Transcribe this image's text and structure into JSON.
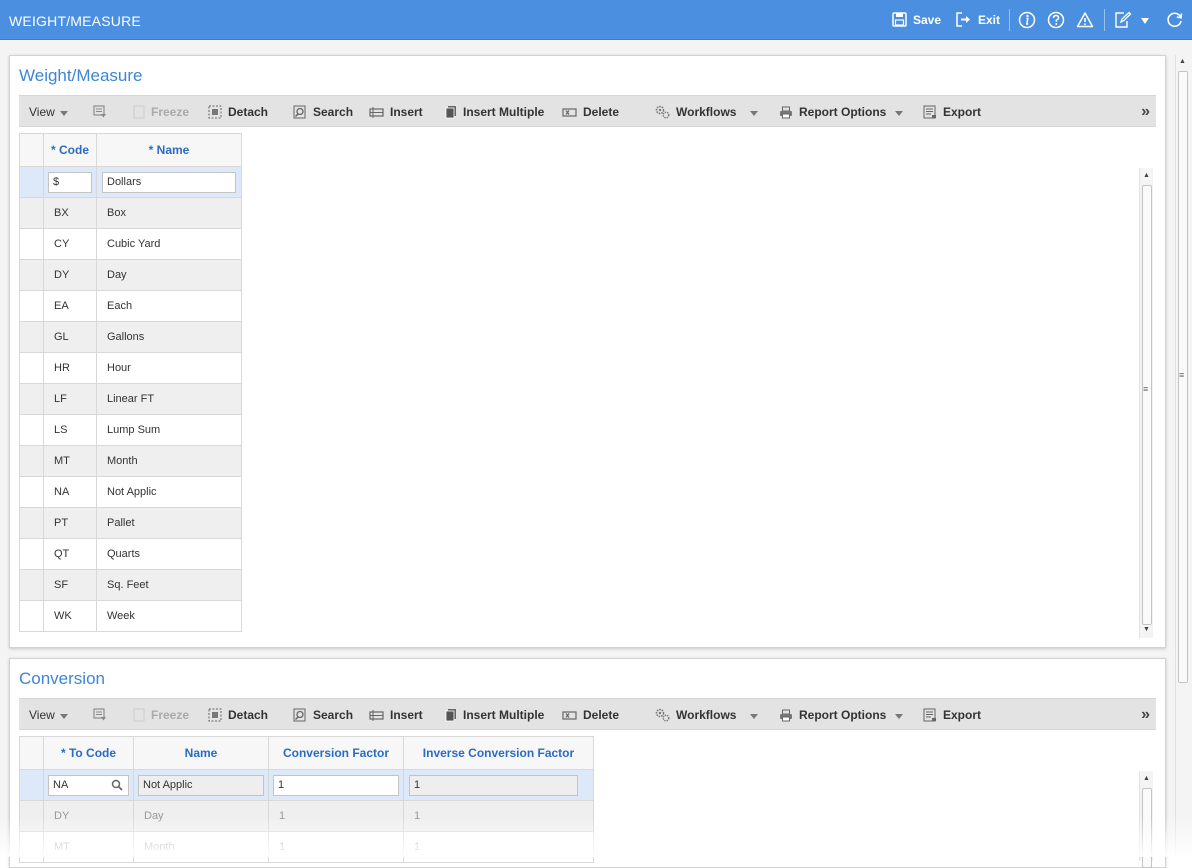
{
  "app": {
    "title": "WEIGHT/MEASURE",
    "save_label": "Save",
    "exit_label": "Exit"
  },
  "toolbar": {
    "view": "View",
    "freeze": "Freeze",
    "detach": "Detach",
    "search": "Search",
    "insert": "Insert",
    "insert_multiple": "Insert Multiple",
    "delete": "Delete",
    "workflows": "Workflows",
    "report_options": "Report Options",
    "export": "Export",
    "overflow": "»"
  },
  "weight_measure": {
    "title": "Weight/Measure",
    "columns": {
      "code": "* Code",
      "name": "* Name"
    },
    "selected": {
      "code": "$",
      "name": "Dollars"
    },
    "rows": [
      {
        "code": "BX",
        "name": "Box"
      },
      {
        "code": "CY",
        "name": "Cubic Yard"
      },
      {
        "code": "DY",
        "name": "Day"
      },
      {
        "code": "EA",
        "name": "Each"
      },
      {
        "code": "GL",
        "name": "Gallons"
      },
      {
        "code": "HR",
        "name": "Hour"
      },
      {
        "code": "LF",
        "name": "Linear FT"
      },
      {
        "code": "LS",
        "name": "Lump Sum"
      },
      {
        "code": "MT",
        "name": "Month"
      },
      {
        "code": "NA",
        "name": "Not Applic"
      },
      {
        "code": "PT",
        "name": "Pallet"
      },
      {
        "code": "QT",
        "name": "Quarts"
      },
      {
        "code": "SF",
        "name": "Sq. Feet"
      },
      {
        "code": "WK",
        "name": "Week"
      }
    ]
  },
  "conversion": {
    "title": "Conversion",
    "columns": {
      "to_code": "* To Code",
      "name": "Name",
      "factor": "Conversion Factor",
      "inverse": "Inverse Conversion Factor"
    },
    "selected": {
      "to_code": "NA",
      "name": "Not Applic",
      "factor": "1",
      "inverse": "1"
    },
    "rows": [
      {
        "to_code": "DY",
        "name": "Day",
        "factor": "1",
        "inverse": "1"
      },
      {
        "to_code": "MT",
        "name": "Month",
        "factor": "1",
        "inverse": "1"
      }
    ]
  },
  "colors": {
    "accent": "#4a8fe0",
    "header_text": "#2a6cc4",
    "title_text": "#3c86d8"
  },
  "icons": [
    "save-icon",
    "exit-icon",
    "info-icon",
    "help-icon",
    "warning-icon",
    "edit-icon",
    "refresh-icon",
    "search-icon"
  ]
}
